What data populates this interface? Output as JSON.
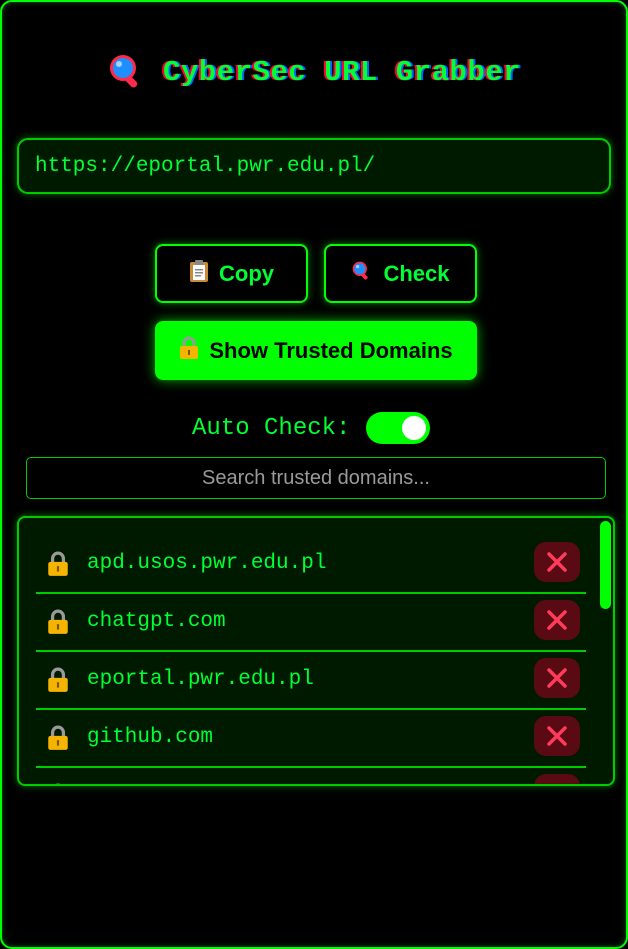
{
  "header": {
    "title": "CyberSec URL Grabber",
    "icon": "magnifier-icon"
  },
  "url_field": {
    "value": "https://eportal.pwr.edu.pl/"
  },
  "buttons": {
    "copy_label": "Copy",
    "check_label": "Check",
    "trusted_label": "Show Trusted Domains"
  },
  "auto_check": {
    "label": "Auto Check:",
    "enabled": true
  },
  "search": {
    "placeholder": "Search trusted domains..."
  },
  "trusted_domains": [
    {
      "domain": "apd.usos.pwr.edu.pl"
    },
    {
      "domain": "chatgpt.com"
    },
    {
      "domain": "eportal.pwr.edu.pl"
    },
    {
      "domain": "github.com"
    }
  ],
  "colors": {
    "accent": "#00ff00",
    "background": "#000000",
    "delete_bg": "#5a0a12",
    "delete_x": "#ff3b5c"
  }
}
